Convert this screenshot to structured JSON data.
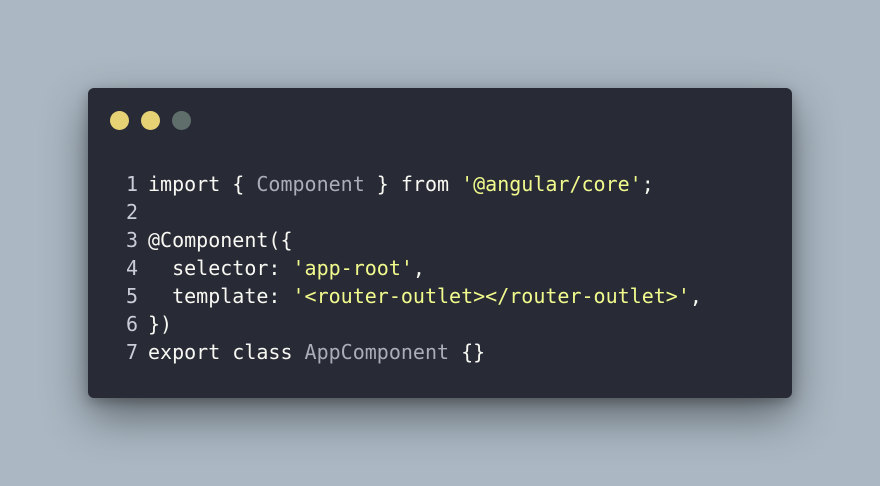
{
  "colors": {
    "background": "#abb8c3",
    "window": "#282a36",
    "dot_1": "#e6d274",
    "dot_2": "#e6d274",
    "dot_3": "#5f6e6b",
    "keyword": "#f8f8f2",
    "identifier": "#a9aeb8",
    "string": "#f1fa8c",
    "decorator": "#f8f8f2",
    "line_number": "#c9ced6"
  },
  "window_controls": [
    "dot-yellow",
    "dot-yellow",
    "dot-gray"
  ],
  "code_lines": [
    {
      "number": "1",
      "tokens": [
        {
          "text": "import { ",
          "type": "keyword"
        },
        {
          "text": "Component",
          "type": "identifier"
        },
        {
          "text": " } from ",
          "type": "keyword"
        },
        {
          "text": "'@angular/core'",
          "type": "string"
        },
        {
          "text": ";",
          "type": "keyword"
        }
      ]
    },
    {
      "number": "2",
      "tokens": []
    },
    {
      "number": "3",
      "tokens": [
        {
          "text": "@Component({",
          "type": "decorator"
        }
      ]
    },
    {
      "number": "4",
      "tokens": [
        {
          "text": "  selector: ",
          "type": "keyword"
        },
        {
          "text": "'app-root'",
          "type": "string"
        },
        {
          "text": ",",
          "type": "keyword"
        }
      ]
    },
    {
      "number": "5",
      "tokens": [
        {
          "text": "  template: ",
          "type": "keyword"
        },
        {
          "text": "'<router-outlet></router-outlet>'",
          "type": "string"
        },
        {
          "text": ",",
          "type": "keyword"
        }
      ]
    },
    {
      "number": "6",
      "tokens": [
        {
          "text": "})",
          "type": "keyword"
        }
      ]
    },
    {
      "number": "7",
      "tokens": [
        {
          "text": "export class ",
          "type": "keyword"
        },
        {
          "text": "AppComponent",
          "type": "identifier"
        },
        {
          "text": " {}",
          "type": "keyword"
        }
      ]
    }
  ]
}
